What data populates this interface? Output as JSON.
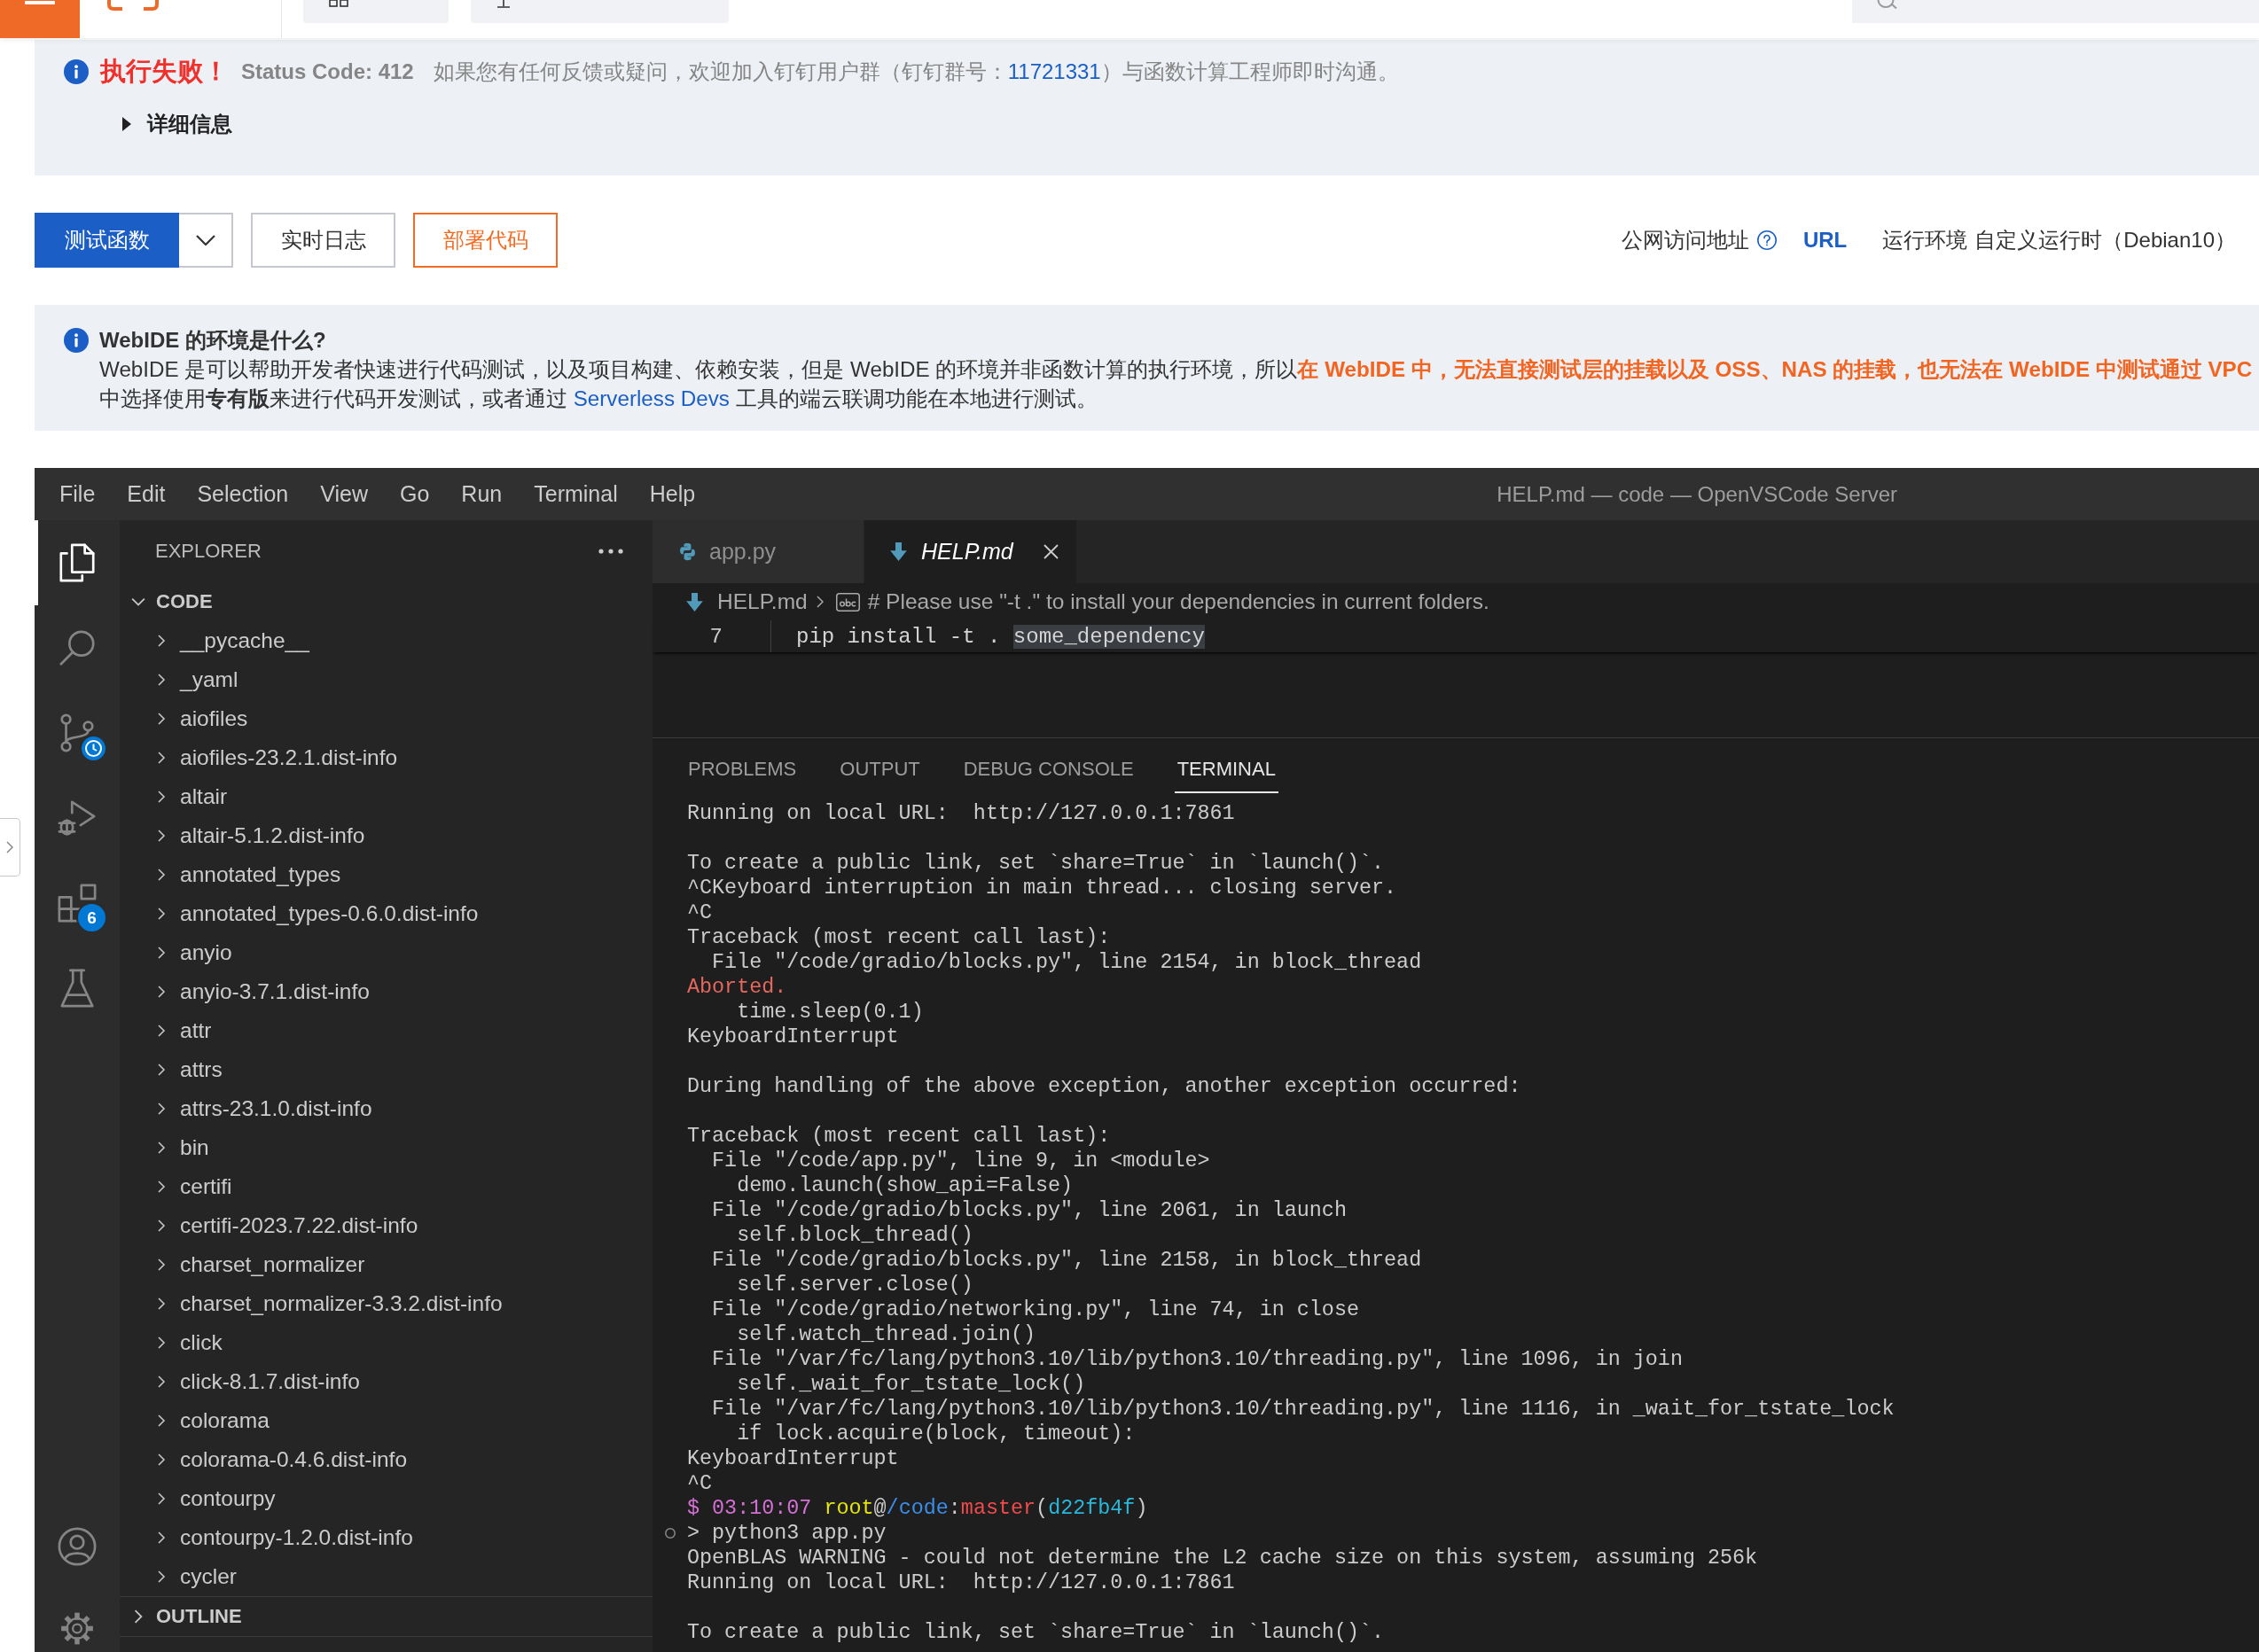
{
  "error_banner": {
    "title": "执行失败！",
    "status": "Status Code: 412",
    "message": {
      "before": "如果您有任何反馈或疑问，欢迎加入钉钉用户群（钉钉群号：",
      "link": "11721331",
      "after": "）与函数计算工程师即时沟通。"
    },
    "details": {
      "label": "详细信息",
      "expanded": false
    }
  },
  "actions": {
    "buttons": [
      {
        "label": "测试函数",
        "kind": "primary",
        "has_menu": true
      },
      {
        "label": "实时日志",
        "kind": "default",
        "has_menu": false
      },
      {
        "label": "部署代码",
        "kind": "accent",
        "has_menu": false
      }
    ],
    "endpoint": {
      "label": "公网访问地址",
      "link": "URL"
    },
    "runtime": {
      "label": "运行环境",
      "value": "自定义运行时（Debian10）"
    }
  },
  "info": {
    "title": "WebIDE 的环境是什么?",
    "lines": [
      [
        {
          "kind": "text",
          "text": "WebIDE 是可以帮助开发者快速进行代码测试，以及项目构建、依赖安装，但是 WebIDE 的环境并非函数计算的执行环境，所以"
        },
        {
          "kind": "warning",
          "text": "在 WebIDE 中，无法直接测试层的挂载以及 OSS、NAS 的挂载，也无法在 WebIDE 中测试通过 VPC"
        }
      ],
      [
        {
          "kind": "text",
          "text": "中选择使用"
        },
        {
          "kind": "strong",
          "text": "专有版"
        },
        {
          "kind": "text",
          "text": "来进行代码开发测试，或者通过 "
        },
        {
          "kind": "link",
          "text": "Serverless Devs"
        },
        {
          "kind": "text",
          "text": " 工具的端云联调功能在本地进行测试。"
        }
      ]
    ]
  },
  "ide": {
    "menu": [
      "File",
      "Edit",
      "Selection",
      "View",
      "Go",
      "Run",
      "Terminal",
      "Help"
    ],
    "title": "HELP.md — code — OpenVSCode Server",
    "activity": [
      {
        "kind": "explorer",
        "selected": true
      },
      {
        "kind": "search",
        "selected": false
      },
      {
        "kind": "source_control",
        "selected": false,
        "busy": true
      },
      {
        "kind": "run_debug",
        "selected": false
      },
      {
        "kind": "extensions",
        "selected": false,
        "badge": "6"
      },
      {
        "kind": "testing",
        "selected": false
      }
    ],
    "activity_bottom": [
      {
        "kind": "account"
      },
      {
        "kind": "settings"
      }
    ],
    "explorer": {
      "title": "EXPLORER",
      "sections": [
        {
          "title": "CODE",
          "expanded": true,
          "items": [
            {
              "name": "__pycache__",
              "expanded": false
            },
            {
              "name": "_yaml",
              "expanded": false
            },
            {
              "name": "aiofiles",
              "expanded": false
            },
            {
              "name": "aiofiles-23.2.1.dist-info",
              "expanded": false
            },
            {
              "name": "altair",
              "expanded": false
            },
            {
              "name": "altair-5.1.2.dist-info",
              "expanded": false
            },
            {
              "name": "annotated_types",
              "expanded": false
            },
            {
              "name": "annotated_types-0.6.0.dist-info",
              "expanded": false
            },
            {
              "name": "anyio",
              "expanded": false
            },
            {
              "name": "anyio-3.7.1.dist-info",
              "expanded": false
            },
            {
              "name": "attr",
              "expanded": false
            },
            {
              "name": "attrs",
              "expanded": false
            },
            {
              "name": "attrs-23.1.0.dist-info",
              "expanded": false
            },
            {
              "name": "bin",
              "expanded": false
            },
            {
              "name": "certifi",
              "expanded": false
            },
            {
              "name": "certifi-2023.7.22.dist-info",
              "expanded": false
            },
            {
              "name": "charset_normalizer",
              "expanded": false
            },
            {
              "name": "charset_normalizer-3.3.2.dist-info",
              "expanded": false
            },
            {
              "name": "click",
              "expanded": false
            },
            {
              "name": "click-8.1.7.dist-info",
              "expanded": false
            },
            {
              "name": "colorama",
              "expanded": false
            },
            {
              "name": "colorama-0.4.6.dist-info",
              "expanded": false
            },
            {
              "name": "contourpy",
              "expanded": false
            },
            {
              "name": "contourpy-1.2.0.dist-info",
              "expanded": false
            },
            {
              "name": "cycler",
              "expanded": false
            }
          ]
        },
        {
          "title": "OUTLINE",
          "expanded": false
        }
      ]
    },
    "editor": {
      "tabs": [
        {
          "label": "app.py",
          "kind": "python",
          "selected": false,
          "preview": false
        },
        {
          "label": "HELP.md",
          "kind": "markdown",
          "selected": true,
          "preview": true
        }
      ],
      "breadcrumb": [
        {
          "kind": "file",
          "text": "HELP.md"
        },
        {
          "kind": "string",
          "text": "# Please use \"-t .\" to install your dependencies in current folders."
        }
      ],
      "lines": [
        {
          "number": "7",
          "segments": [
            {
              "text": "pip install -t . ",
              "highlighted": false
            },
            {
              "text": "some_dependency",
              "highlighted": true
            }
          ]
        }
      ]
    },
    "panel": {
      "tabs": [
        {
          "label": "PROBLEMS",
          "selected": false
        },
        {
          "label": "OUTPUT",
          "selected": false
        },
        {
          "label": "DEBUG CONSOLE",
          "selected": false
        },
        {
          "label": "TERMINAL",
          "selected": true
        }
      ],
      "terminal": [
        {
          "kind": "text",
          "text": "Running on local URL:  http://127.0.0.1:7861"
        },
        {
          "kind": "blank"
        },
        {
          "kind": "text",
          "text": "To create a public link, set `share=True` in `launch()`."
        },
        {
          "kind": "text",
          "text": "^CKeyboard interruption in main thread... closing server."
        },
        {
          "kind": "text",
          "text": "^C"
        },
        {
          "kind": "text",
          "text": "Traceback (most recent call last):"
        },
        {
          "kind": "text",
          "text": "  File \"/code/gradio/blocks.py\", line 2154, in block_thread"
        },
        {
          "kind": "error",
          "text": "Aborted."
        },
        {
          "kind": "text",
          "text": "    time.sleep(0.1)"
        },
        {
          "kind": "text",
          "text": "KeyboardInterrupt"
        },
        {
          "kind": "blank"
        },
        {
          "kind": "text",
          "text": "During handling of the above exception, another exception occurred:"
        },
        {
          "kind": "blank"
        },
        {
          "kind": "text",
          "text": "Traceback (most recent call last):"
        },
        {
          "kind": "text",
          "text": "  File \"/code/app.py\", line 9, in <module>"
        },
        {
          "kind": "text",
          "text": "    demo.launch(show_api=False)"
        },
        {
          "kind": "text",
          "text": "  File \"/code/gradio/blocks.py\", line 2061, in launch"
        },
        {
          "kind": "text",
          "text": "    self.block_thread()"
        },
        {
          "kind": "text",
          "text": "  File \"/code/gradio/blocks.py\", line 2158, in block_thread"
        },
        {
          "kind": "text",
          "text": "    self.server.close()"
        },
        {
          "kind": "text",
          "text": "  File \"/code/gradio/networking.py\", line 74, in close"
        },
        {
          "kind": "text",
          "text": "    self.watch_thread.join()"
        },
        {
          "kind": "text",
          "text": "  File \"/var/fc/lang/python3.10/lib/python3.10/threading.py\", line 1096, in join"
        },
        {
          "kind": "text",
          "text": "    self._wait_for_tstate_lock()"
        },
        {
          "kind": "text",
          "text": "  File \"/var/fc/lang/python3.10/lib/python3.10/threading.py\", line 1116, in _wait_for_tstate_lock"
        },
        {
          "kind": "text",
          "text": "    if lock.acquire(block, timeout):"
        },
        {
          "kind": "text",
          "text": "KeyboardInterrupt"
        },
        {
          "kind": "text",
          "text": "^C"
        },
        {
          "kind": "prompt",
          "segments": [
            {
              "kind": "time",
              "text": "$ 03:10:07 "
            },
            {
              "kind": "user",
              "text": "root"
            },
            {
              "kind": "plain",
              "text": "@"
            },
            {
              "kind": "path",
              "text": "/code"
            },
            {
              "kind": "plain",
              "text": ":"
            },
            {
              "kind": "branch",
              "text": "master"
            },
            {
              "kind": "plain",
              "text": "("
            },
            {
              "kind": "hash",
              "text": "d22fb4f"
            },
            {
              "kind": "plain",
              "text": ")"
            }
          ]
        },
        {
          "kind": "command",
          "text": "> python3 app.py"
        },
        {
          "kind": "text",
          "text": "OpenBLAS WARNING - could not determine the L2 cache size on this system, assuming 256k"
        },
        {
          "kind": "text",
          "text": "Running on local URL:  http://127.0.0.1:7861"
        },
        {
          "kind": "blank"
        },
        {
          "kind": "text",
          "text": "To create a public link, set `share=True` in `launch()`."
        }
      ]
    }
  }
}
